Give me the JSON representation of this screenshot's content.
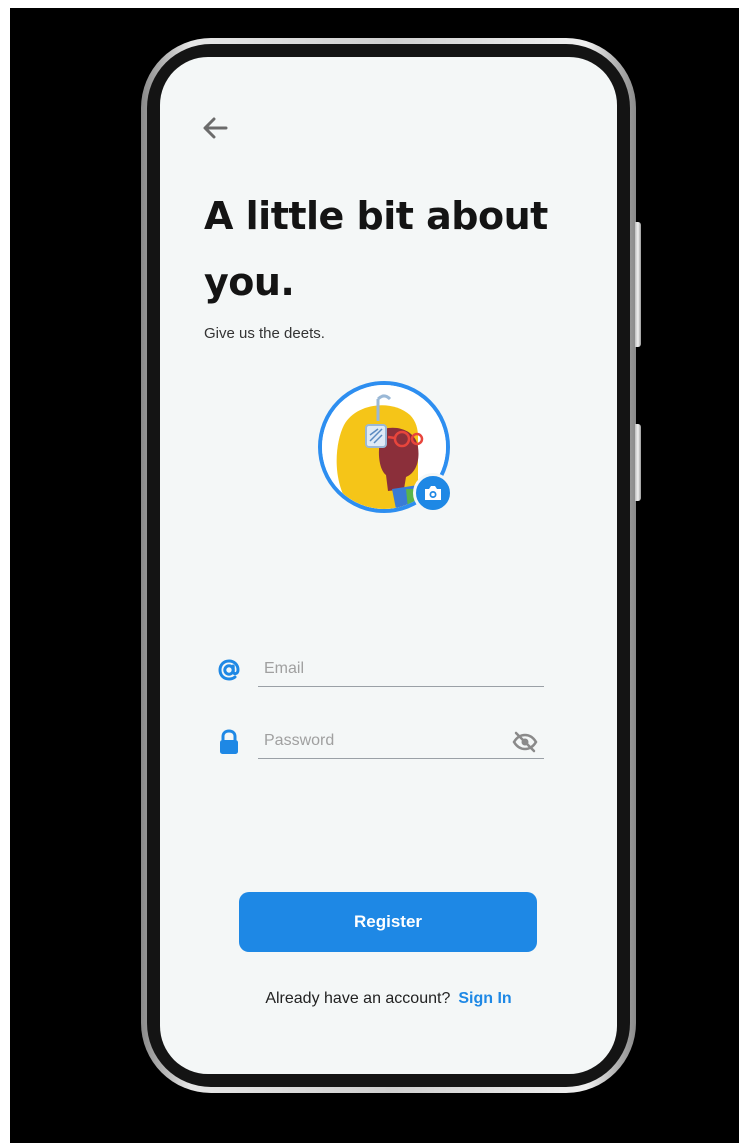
{
  "header": {
    "title": "A little bit about you.",
    "subtitle": "Give us the deets."
  },
  "icons": {
    "back": "arrow-left-icon",
    "camera": "camera-icon",
    "email": "at-sign-icon",
    "password": "lock-icon",
    "visibility": "eye-off-icon"
  },
  "form": {
    "email_placeholder": "Email",
    "password_placeholder": "Password"
  },
  "actions": {
    "register_label": "Register"
  },
  "footer": {
    "prompt": "Already have an account?",
    "sign_in_label": "Sign In"
  },
  "colors": {
    "accent": "#1e88e5",
    "screen_background": "#f4f7f7",
    "title_text": "#141414"
  }
}
